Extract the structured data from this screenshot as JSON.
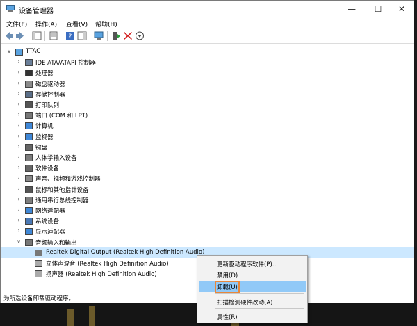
{
  "window": {
    "title": "设备管理器",
    "controls": {
      "minimize": "—",
      "maximize": "☐",
      "close": "✕"
    }
  },
  "menu": [
    "文件(F)",
    "操作(A)",
    "查看(V)",
    "帮助(H)"
  ],
  "tree": {
    "root": "TTAC",
    "categories": [
      "IDE ATA/ATAPI 控制器",
      "处理器",
      "磁盘驱动器",
      "存储控制器",
      "打印队列",
      "端口 (COM 和 LPT)",
      "计算机",
      "监视器",
      "键盘",
      "人体学输入设备",
      "软件设备",
      "声音、视频和游戏控制器",
      "鼠标和其他指针设备",
      "通用串行总线控制器",
      "网络适配器",
      "系统设备",
      "显示适配器",
      "音频输入和输出"
    ],
    "audio_children": [
      "Realtek Digital Output (Realtek High Definition Audio)",
      "立体声混音 (Realtek High Definition Audio)",
      "扬声器 (Realtek High Definition Audio)"
    ]
  },
  "status": "为所选设备卸载驱动程序。",
  "context_menu": {
    "items": [
      "更新驱动程序软件(P)...",
      "禁用(D)",
      "卸载(U)",
      "扫描检测硬件改动(A)",
      "属性(R)"
    ],
    "highlighted": "卸载(U)"
  },
  "colors": {
    "selection": "#cce8ff",
    "menu_highlight": "#91c9f7",
    "focus_outline": "#e8873a"
  }
}
